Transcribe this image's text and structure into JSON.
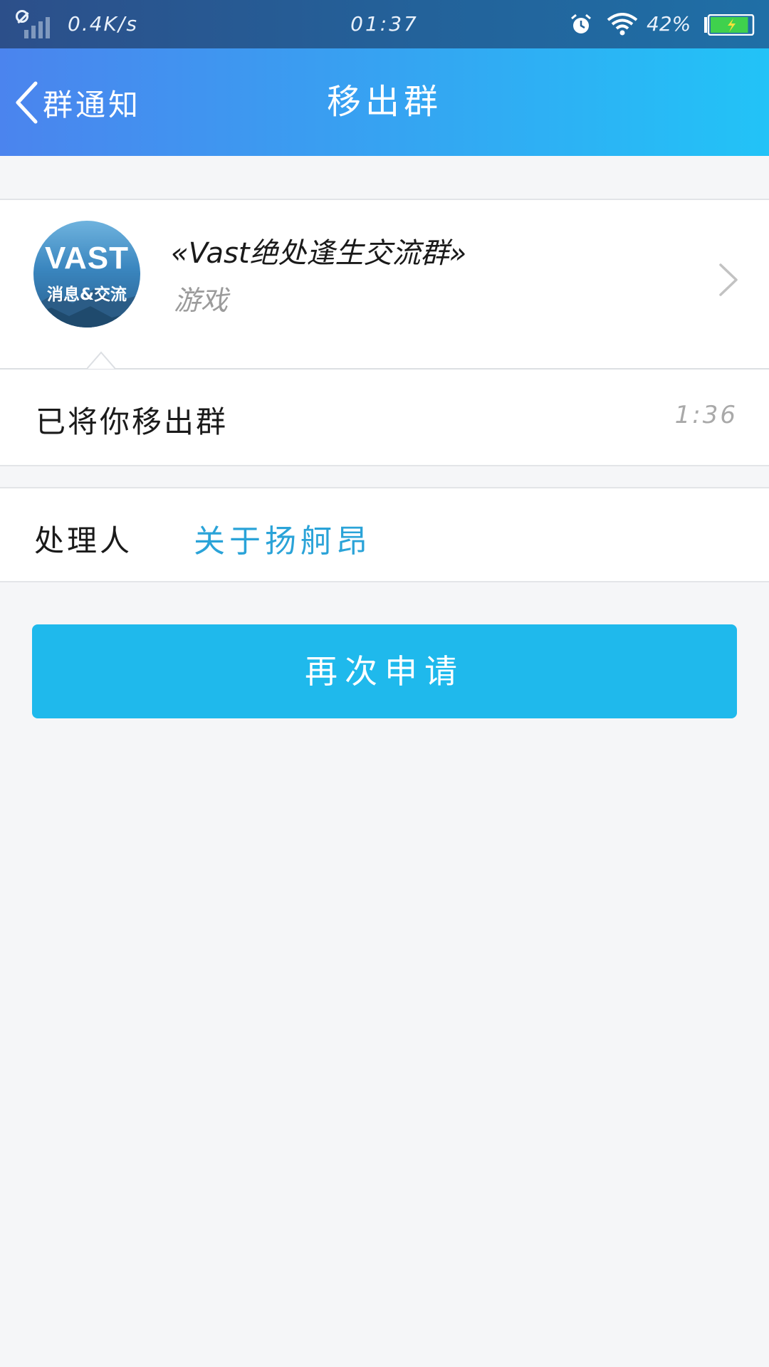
{
  "status_bar": {
    "net_speed": "0.4K/s",
    "time": "01:37",
    "battery_percent": "42%",
    "battery_level": 0.42,
    "icons": [
      "no-signal-icon",
      "alarm-icon",
      "wifi-icon",
      "battery-charging-icon"
    ]
  },
  "header": {
    "back_label": "群通知",
    "title": "移出群",
    "colors": {
      "start": "#4b84ee",
      "end": "#22c3f7"
    }
  },
  "group": {
    "avatar_title": "VAST",
    "avatar_subtitle": "消息&交流",
    "name": "«Vast绝处逢生交流群»",
    "category": "游戏"
  },
  "message": {
    "text": "已将你移出群",
    "time": "1:36"
  },
  "handler": {
    "label": "处理人",
    "name": "关于扬舸昂",
    "name_color": "#2aa3d8"
  },
  "action": {
    "reapply_label": "再次申请",
    "color": "#1fb9ec"
  }
}
